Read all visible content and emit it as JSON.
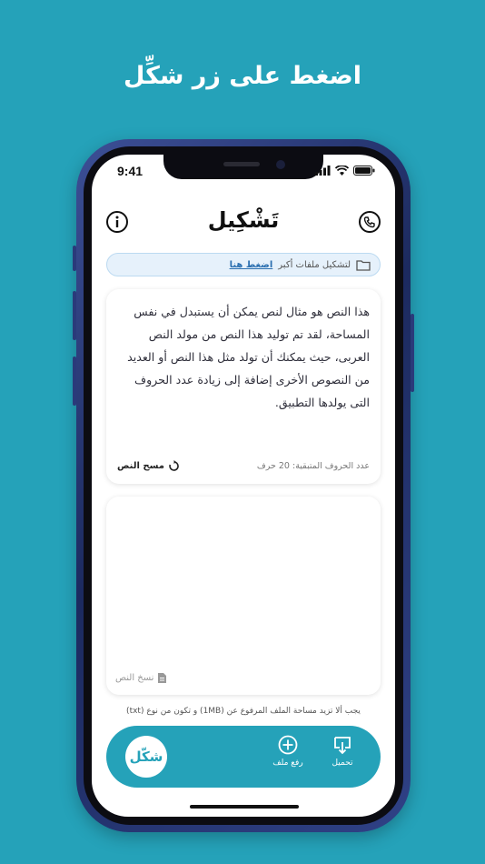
{
  "headline": "اضغط على زر شكِّل",
  "status_bar": {
    "time": "9:41"
  },
  "app": {
    "title": "تَشْكِيل"
  },
  "banner": {
    "text": "لتشكيل ملفات أكبر",
    "link": "اضغط هنا"
  },
  "input_card": {
    "text": "هذا النص هو مثال لنص يمكن أن يستبدل في نفس المساحة، لقد تم توليد هذا النص من مولد النص العربى، حيث يمكنك أن تولد مثل هذا النص أو العديد من النصوص الأخرى إضافة إلى زيادة عدد الحروف التى يولدها التطبيق.",
    "remaining": "عدد الحروف المتبقية: 20 حرف",
    "clear_label": "مسح النص"
  },
  "result_card": {
    "text": "",
    "copy_label": "نسخ النص"
  },
  "note": "يجب ألا تزيد مساحة الملف المرفوع عن (1MB) و تكون من نوع (txt)",
  "bottom_bar": {
    "shakl_label": "شكّل",
    "upload_label": "رفع ملف",
    "download_label": "تحميل"
  }
}
